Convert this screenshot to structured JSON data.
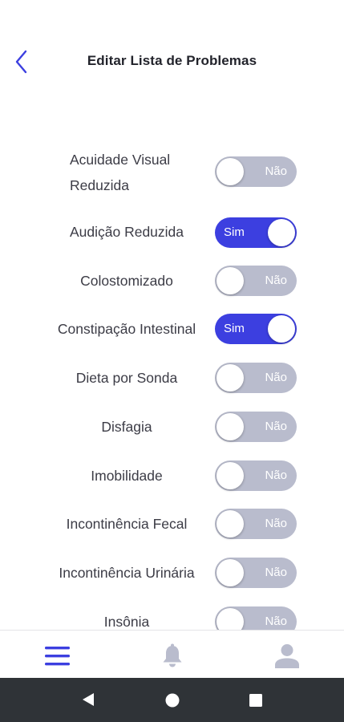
{
  "header": {
    "title": "Editar Lista de Problemas"
  },
  "problems": [
    {
      "label": "Acuidade Visual\nReduzida",
      "state": "Não",
      "on": false
    },
    {
      "label": "Audição Reduzida",
      "state": "Sim",
      "on": true
    },
    {
      "label": "Colostomizado",
      "state": "Não",
      "on": false
    },
    {
      "label": "Constipação Intestinal",
      "state": "Sim",
      "on": true
    },
    {
      "label": "Dieta por Sonda",
      "state": "Não",
      "on": false
    },
    {
      "label": "Disfagia",
      "state": "Não",
      "on": false
    },
    {
      "label": "Imobilidade",
      "state": "Não",
      "on": false
    },
    {
      "label": "Incontinência Fecal",
      "state": "Não",
      "on": false
    },
    {
      "label": "Incontinência Urinária",
      "state": "Não",
      "on": false
    },
    {
      "label": "Insônia",
      "state": "Não",
      "on": false
    }
  ],
  "tabbar": {
    "items": [
      "menu-icon",
      "bell-icon",
      "person-icon"
    ],
    "active": 0
  },
  "colors": {
    "accent": "#3c3fe0",
    "toggle_off": "#b9bccd",
    "nav_bg": "#2f3337"
  }
}
